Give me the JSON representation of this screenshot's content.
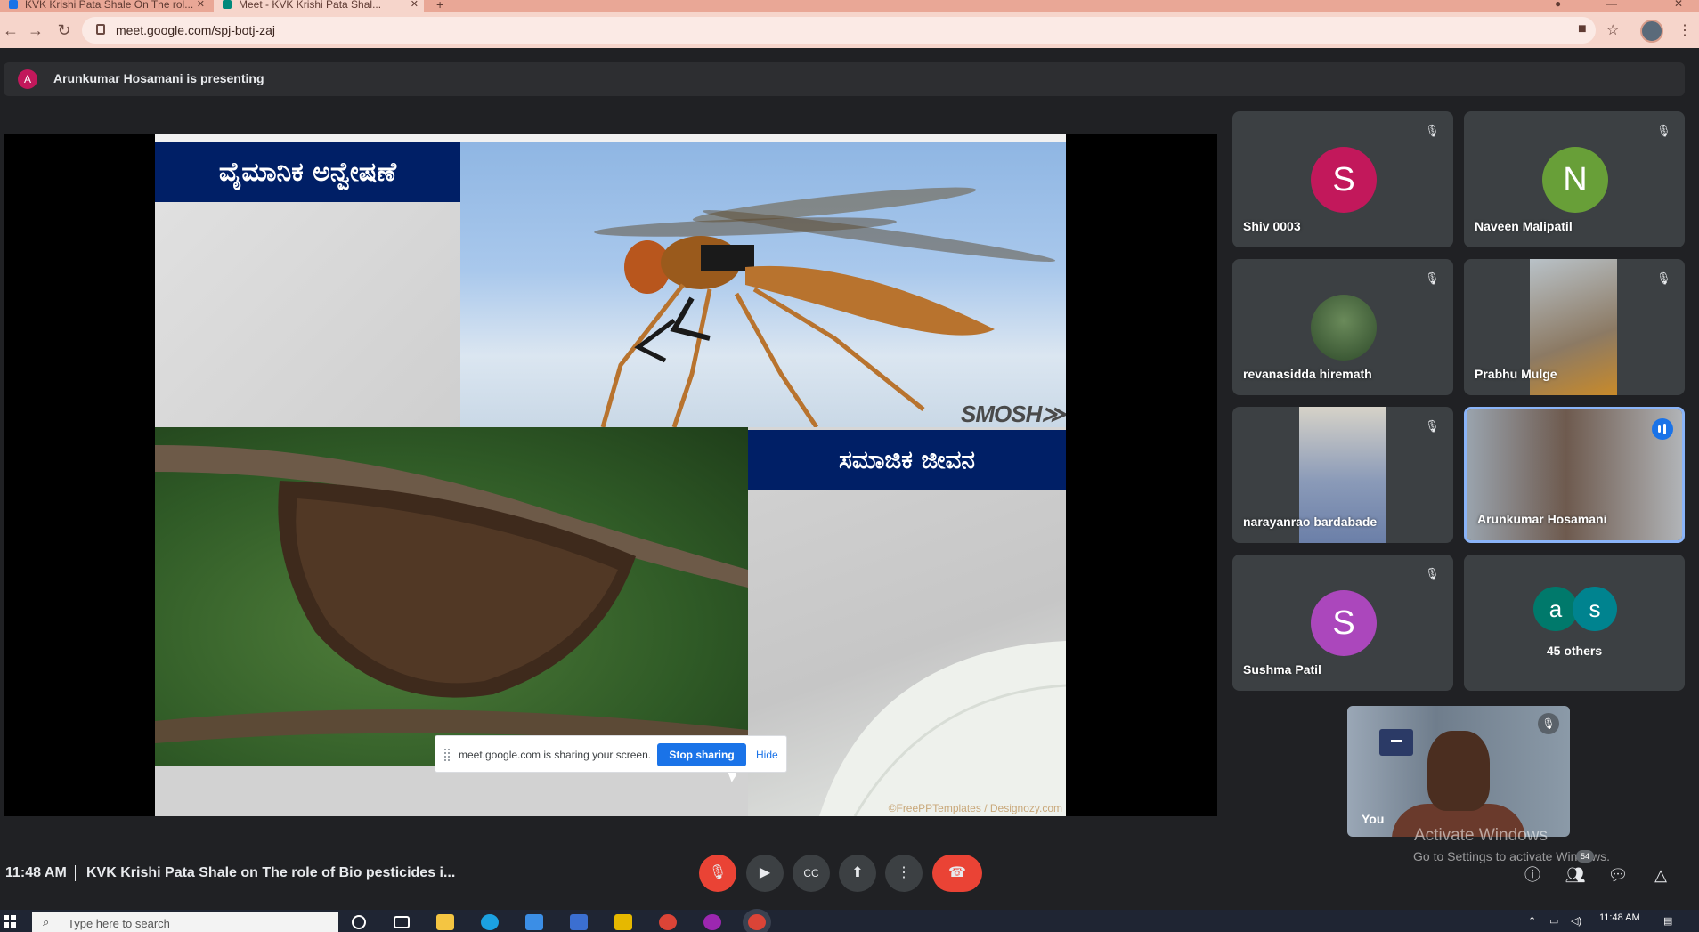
{
  "browser": {
    "tabs": [
      {
        "label": "KVK Krishi Pata Shale On The rol..."
      },
      {
        "label": "Meet - KVK Krishi Pata Shal..."
      }
    ],
    "new_tab_label": "+",
    "url_host": "meet.google.com",
    "url_path": "/spj-botj-zaj"
  },
  "banner": {
    "presenter_initial": "A",
    "text": "Arunkumar Hosamani is presenting"
  },
  "slide": {
    "title_top": "ವೈಮಾನಿಕ ಅನ್ವೇಷಣೆ",
    "title_bottom": "ಸಮಾಜಿಕ ಜೀವನ",
    "watermark": "SMOSH≫",
    "credit": "©FreePPTemplates / Designozy.com"
  },
  "share_notice": {
    "message": "meet.google.com is sharing your screen.",
    "stop_label": "Stop sharing",
    "hide_label": "Hide"
  },
  "participants": [
    {
      "name": "Shiv 0003",
      "initial": "S",
      "color": "#c2185b"
    },
    {
      "name": "Naveen Malipatil",
      "initial": "N",
      "color": "#689f38"
    },
    {
      "name": "revanasidda hiremath"
    },
    {
      "name": "Prabhu Mulge"
    },
    {
      "name": "narayanrao bardabade"
    },
    {
      "name": "Arunkumar Hosamani"
    },
    {
      "name": "Sushma Patil",
      "initial": "S",
      "color": "#ab47bc"
    }
  ],
  "others": {
    "initials": [
      "a",
      "s"
    ],
    "label": "45 others"
  },
  "self": {
    "label": "You"
  },
  "activation": {
    "line1": "Activate Windows",
    "line2": "Go to Settings to activate Windows."
  },
  "bottombar": {
    "time": "11:48 AM",
    "meeting_title": "KVK Krishi Pata Shale on The role of Bio pesticides i...",
    "people_count": "54"
  },
  "taskbar": {
    "search_placeholder": "Type here to search",
    "clock": "11:48 AM"
  },
  "colors": {
    "meet_bg": "#202124",
    "tile_bg": "#3c4043",
    "leave_red": "#ea4335",
    "slide_title_bg": "#001f66",
    "accent_blue": "#1a73e8"
  }
}
